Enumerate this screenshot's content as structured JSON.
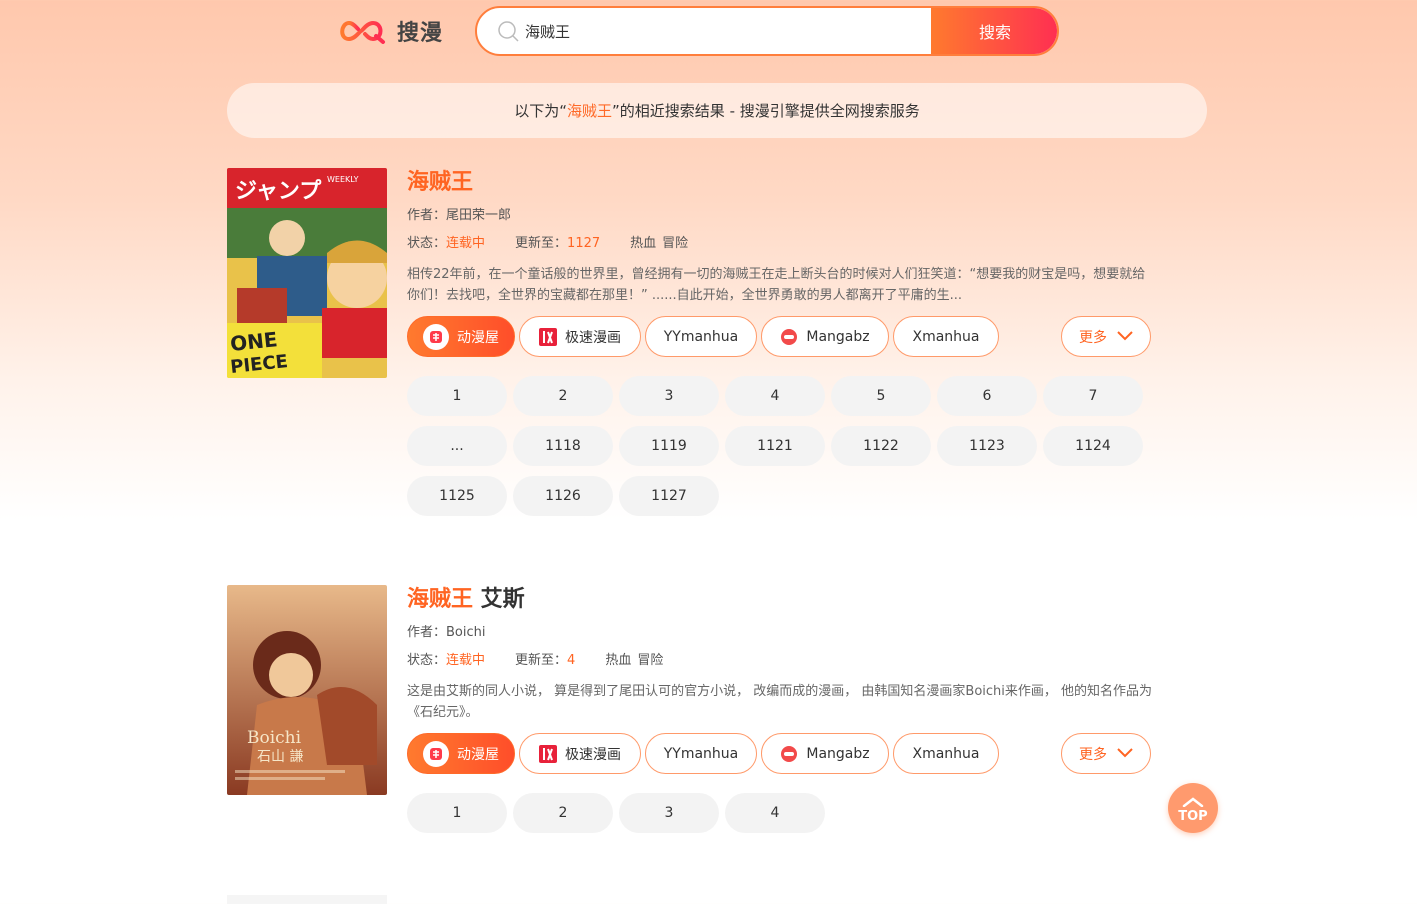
{
  "header": {
    "logo_text": "搜漫",
    "search_value": "海贼王",
    "search_button": "搜索"
  },
  "banner": {
    "prefix": "以下为“",
    "keyword": "海贼王",
    "suffix": "”的相近搜索结果 - 搜漫引擎提供全网搜索服务"
  },
  "results": [
    {
      "title_highlight": "海贼王",
      "title_rest": "",
      "author_label": "作者：",
      "author": "尾田荣一郎",
      "status_label": "状态：",
      "status": "连载中",
      "update_label": "更新至：",
      "update": "1127",
      "tags": [
        "热血",
        "冒险"
      ],
      "description": "相传22年前，在一个童话般的世界里，曾经拥有一切的海贼王在走上断头台的时候对人们狂笑道：“想要我的财宝是吗，想要就给你们！去找吧，全世界的宝藏都在那里！” ......自此开始，全世界勇敢的男人都离开了平庸的生...",
      "sources": [
        "动漫屋",
        "极速漫画",
        "YYmanhua",
        "Mangabz",
        "Xmanhua"
      ],
      "more": "更多",
      "chapters": [
        "1",
        "2",
        "3",
        "4",
        "5",
        "6",
        "7",
        "...",
        "1118",
        "1119",
        "1121",
        "1122",
        "1123",
        "1124",
        "1125",
        "1126",
        "1127"
      ]
    },
    {
      "title_highlight": "海贼王",
      "title_rest": " 艾斯",
      "author_label": "作者：",
      "author": "Boichi",
      "status_label": "状态：",
      "status": "连载中",
      "update_label": "更新至：",
      "update": "4",
      "tags": [
        "热血",
        "冒险"
      ],
      "description": "这是由艾斯的同人小说， 算是得到了尾田认可的官方小说， 改编而成的漫画， 由韩国知名漫画家Boichi来作画， 他的知名作品为《石纪元》。",
      "sources": [
        "动漫屋",
        "极速漫画",
        "YYmanhua",
        "Mangabz",
        "Xmanhua"
      ],
      "more": "更多",
      "chapters": [
        "1",
        "2",
        "3",
        "4"
      ]
    }
  ],
  "cover1_text": [
    "WEEKLY",
    "ONE",
    "PIECE"
  ],
  "cover2_text": [
    "Boichi",
    "石山 謙"
  ],
  "top_button": "TOP",
  "colors": {
    "accent": "#ff6422",
    "gradient_start": "#ff7a2e",
    "gradient_end": "#ff2e52"
  }
}
